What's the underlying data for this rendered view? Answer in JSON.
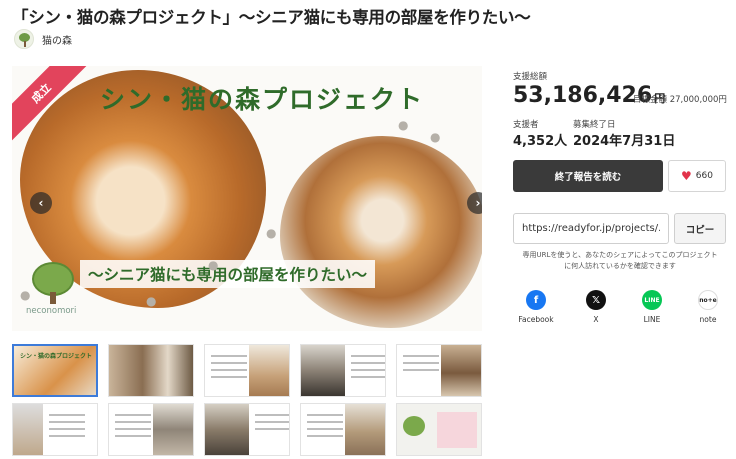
{
  "project": {
    "title": "「シン・猫の森プロジェクト」〜シニア猫にも専用の部屋を作りたい〜",
    "owner": "猫の森"
  },
  "hero": {
    "badge": "成立",
    "heading": "シン・猫の森プロジェクト",
    "subheading": "〜シニア猫にも専用の部屋を作りたい〜",
    "logo_text": "neconomori",
    "prev_label": "‹",
    "next_label": "›"
  },
  "funding": {
    "total_label": "支援総額",
    "total_amount": "53,186,426",
    "currency": "円",
    "goal_label": "目標金額",
    "goal_amount": "27,000,000円",
    "supporters_label": "支援者",
    "supporters_count": "4,352人",
    "end_label": "募集終了日",
    "end_date": "2024年7月31日"
  },
  "actions": {
    "report_button": "終了報告を読む",
    "favorite_count": "660",
    "url_value": "https://readyfor.jp/projects/...",
    "copy_button": "コピー",
    "url_note": "専用URLを使うと、あなたのシェアによってこのプロジェクトに何人訪れているかを確認できます"
  },
  "share": [
    {
      "label": "Facebook",
      "icon": "f"
    },
    {
      "label": "X",
      "icon": "𝕏"
    },
    {
      "label": "LINE",
      "icon": "LINE"
    },
    {
      "label": "note",
      "icon": "no+e"
    }
  ],
  "thumb_texts": {
    "t0": "シン・猫の森プロジェクト"
  },
  "colors": {
    "accent_green": "#2f6b2a",
    "badge_red": "#e2445c",
    "dark_button": "#3a3a3a",
    "heart": "#e2334a"
  }
}
